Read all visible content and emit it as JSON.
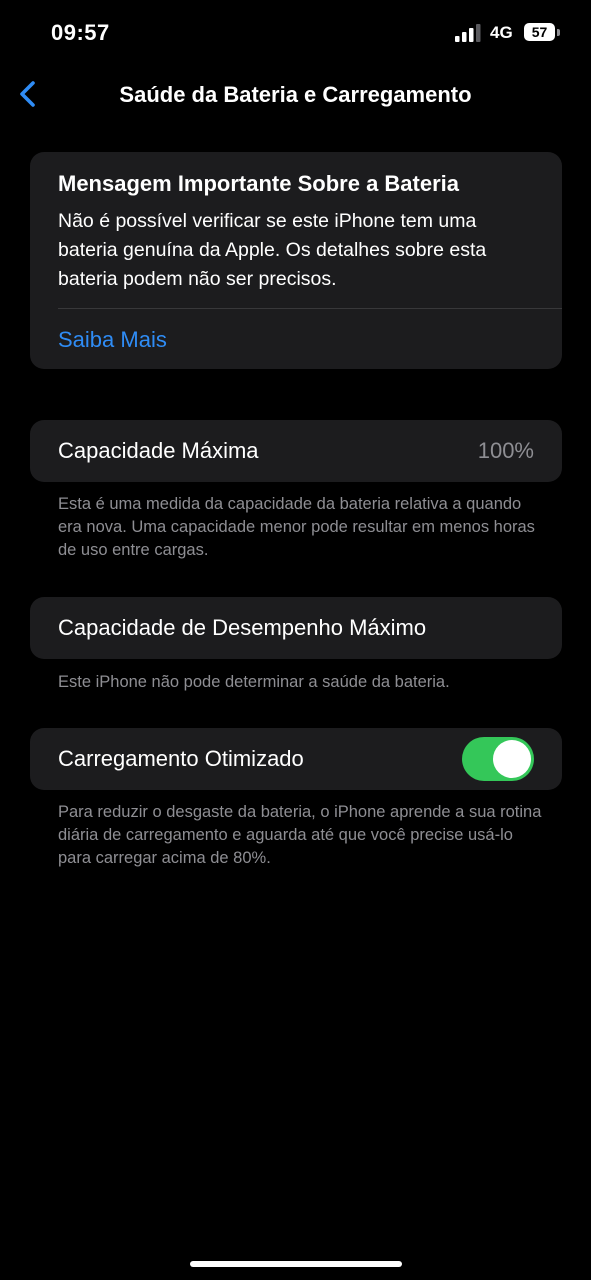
{
  "status_bar": {
    "time": "09:57",
    "network": "4G",
    "battery": "57"
  },
  "nav": {
    "back_icon": "chevron-left-icon",
    "title": "Saúde da Bateria e Carregamento"
  },
  "message_card": {
    "title": "Mensagem Importante Sobre a Bateria",
    "body": "Não é possível verificar se este iPhone tem uma bateria genuína da Apple. Os detalhes sobre esta bateria podem não ser precisos.",
    "link_label": "Saiba Mais"
  },
  "max_capacity": {
    "label": "Capacidade Máxima",
    "value": "100%",
    "footer": "Esta é uma medida da capacidade da bateria relativa a quando era nova. Uma capacidade menor pode resultar em menos horas de uso entre cargas."
  },
  "peak_performance": {
    "label": "Capacidade de Desempenho Máximo",
    "footer": "Este iPhone não pode determinar a saúde da bateria."
  },
  "optimized_charging": {
    "label": "Carregamento Otimizado",
    "enabled": true,
    "footer": "Para reduzir o desgaste da bateria, o iPhone aprende a sua rotina diária de carregamento e aguarda até que você precise usá-lo para carregar acima de 80%."
  },
  "colors": {
    "background": "#000000",
    "card": "#1c1c1e",
    "link": "#2f8cf5",
    "toggle_on": "#34c759",
    "secondary_text": "#8e8e93"
  }
}
